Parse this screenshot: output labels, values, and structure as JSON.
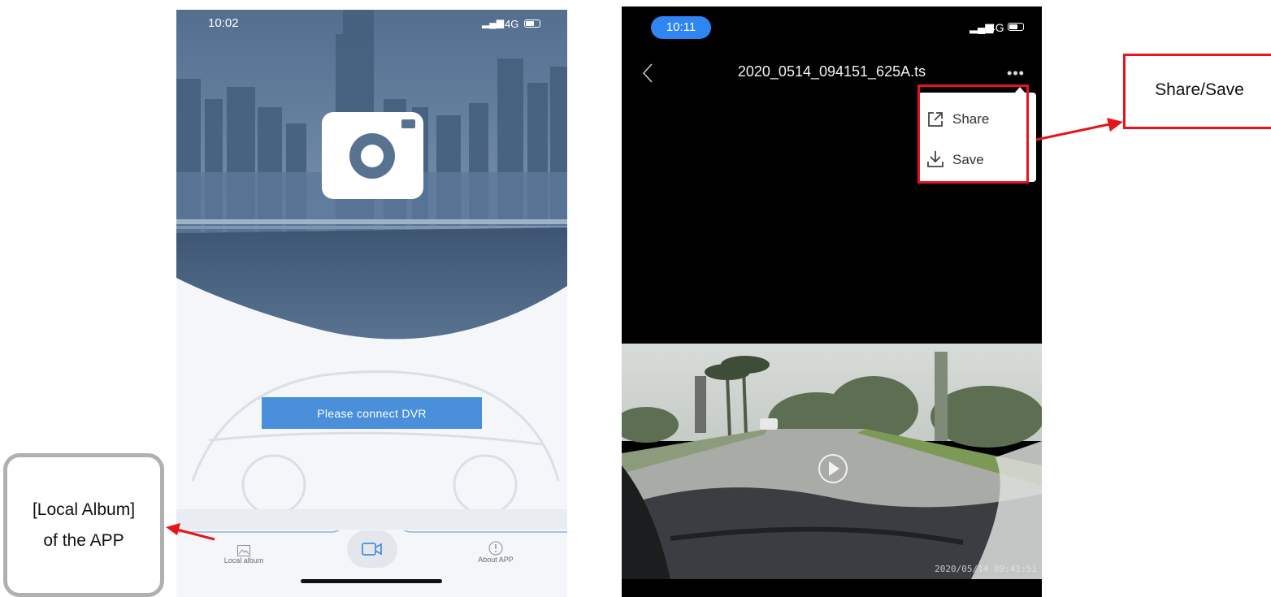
{
  "left_phone": {
    "status": {
      "time": "10:02",
      "network": "4G"
    },
    "logo_icon": "camera-logo-icon",
    "connect_button_label": "Please connect DVR",
    "nav": {
      "local_album_label": "Local album",
      "local_album_icon": "image-icon",
      "center_icon": "video-camera-icon",
      "about_label": "About APP",
      "about_icon": "info-icon"
    }
  },
  "right_phone": {
    "status": {
      "time": "10:11",
      "network": "4G"
    },
    "title": "2020_0514_094151_625A.ts",
    "back_icon": "chevron-left-icon",
    "more_icon": "more-dots-icon",
    "menu": {
      "share_label": "Share",
      "share_icon": "share-icon",
      "save_label": "Save",
      "save_icon": "download-icon"
    },
    "video": {
      "timestamp": "2020/05/14 09:41:51",
      "play_icon": "play-icon"
    }
  },
  "callouts": {
    "share_save": "Share/Save",
    "local_album": "[Local Album] of the APP"
  },
  "colors": {
    "highlight_red": "#e8141b",
    "accent_blue": "#4a8fd9",
    "time_pill_blue": "#2f86f2",
    "callout_gray": "#b0b0b0"
  }
}
